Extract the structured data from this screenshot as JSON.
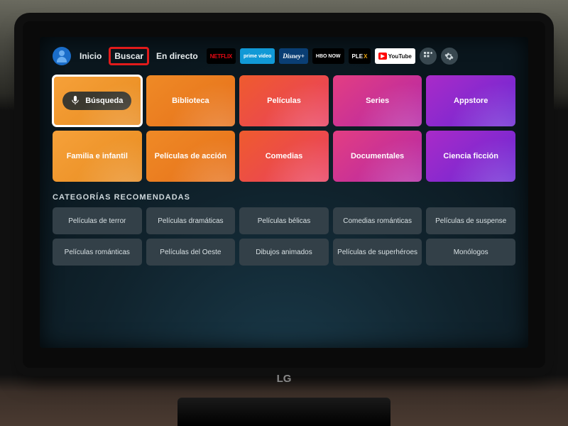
{
  "nav": {
    "items": [
      "Inicio",
      "Buscar",
      "En directo"
    ],
    "highlighted_index": 1,
    "app_tiles": [
      "NETFLIX",
      "prime video",
      "Disney+",
      "HBO NOW",
      "PLEX",
      "YouTube"
    ],
    "apps_icon": "apps-icon",
    "settings_icon": "settings-icon",
    "profile_icon": "profile-icon"
  },
  "search_pill": {
    "label": "Búsqueda",
    "icon": "mic-icon"
  },
  "big_tiles": [
    {
      "label": "Búsqueda",
      "color": 0,
      "active": true,
      "is_search": true
    },
    {
      "label": "Biblioteca",
      "color": 1
    },
    {
      "label": "Películas",
      "color": 2
    },
    {
      "label": "Series",
      "color": 3
    },
    {
      "label": "Appstore",
      "color": 4
    },
    {
      "label": "Familia e infantil",
      "color": 0
    },
    {
      "label": "Películas de acción",
      "color": 1
    },
    {
      "label": "Comedias",
      "color": 2
    },
    {
      "label": "Documentales",
      "color": 3
    },
    {
      "label": "Ciencia ficción",
      "color": 4
    }
  ],
  "section_title": "CATEGORÍAS RECOMENDADAS",
  "recommended": [
    "Películas de terror",
    "Películas dramáticas",
    "Películas bélicas",
    "Comedias románticas",
    "Películas de suspense",
    "Películas románticas",
    "Películas del Oeste",
    "Dibujos animados",
    "Películas de superhéroes",
    "Monólogos"
  ],
  "tv_brand": "LG"
}
